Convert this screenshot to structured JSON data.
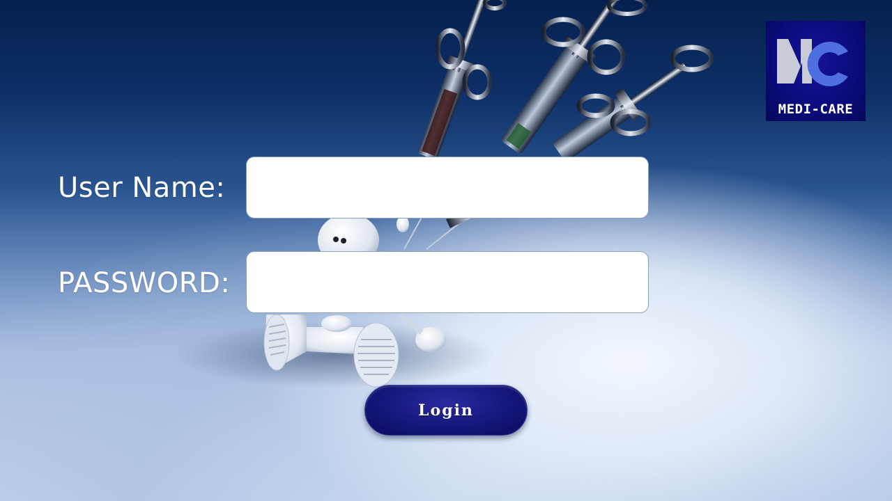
{
  "form": {
    "username_label": "User Name:",
    "username_value": "",
    "password_label": "PASSWORD:",
    "password_value": "",
    "login_label": "Login"
  },
  "logo": {
    "text": "MEDI-CARE",
    "colors": {
      "background": "#0b0b7a",
      "m_letter": "#c9cbd6",
      "c_letter": "#4f6fe0"
    }
  },
  "colors": {
    "button": "#16167c",
    "label_text": "#ffffff",
    "bg_top": "#06204f",
    "bg_bottom": "#c2d2ea"
  }
}
